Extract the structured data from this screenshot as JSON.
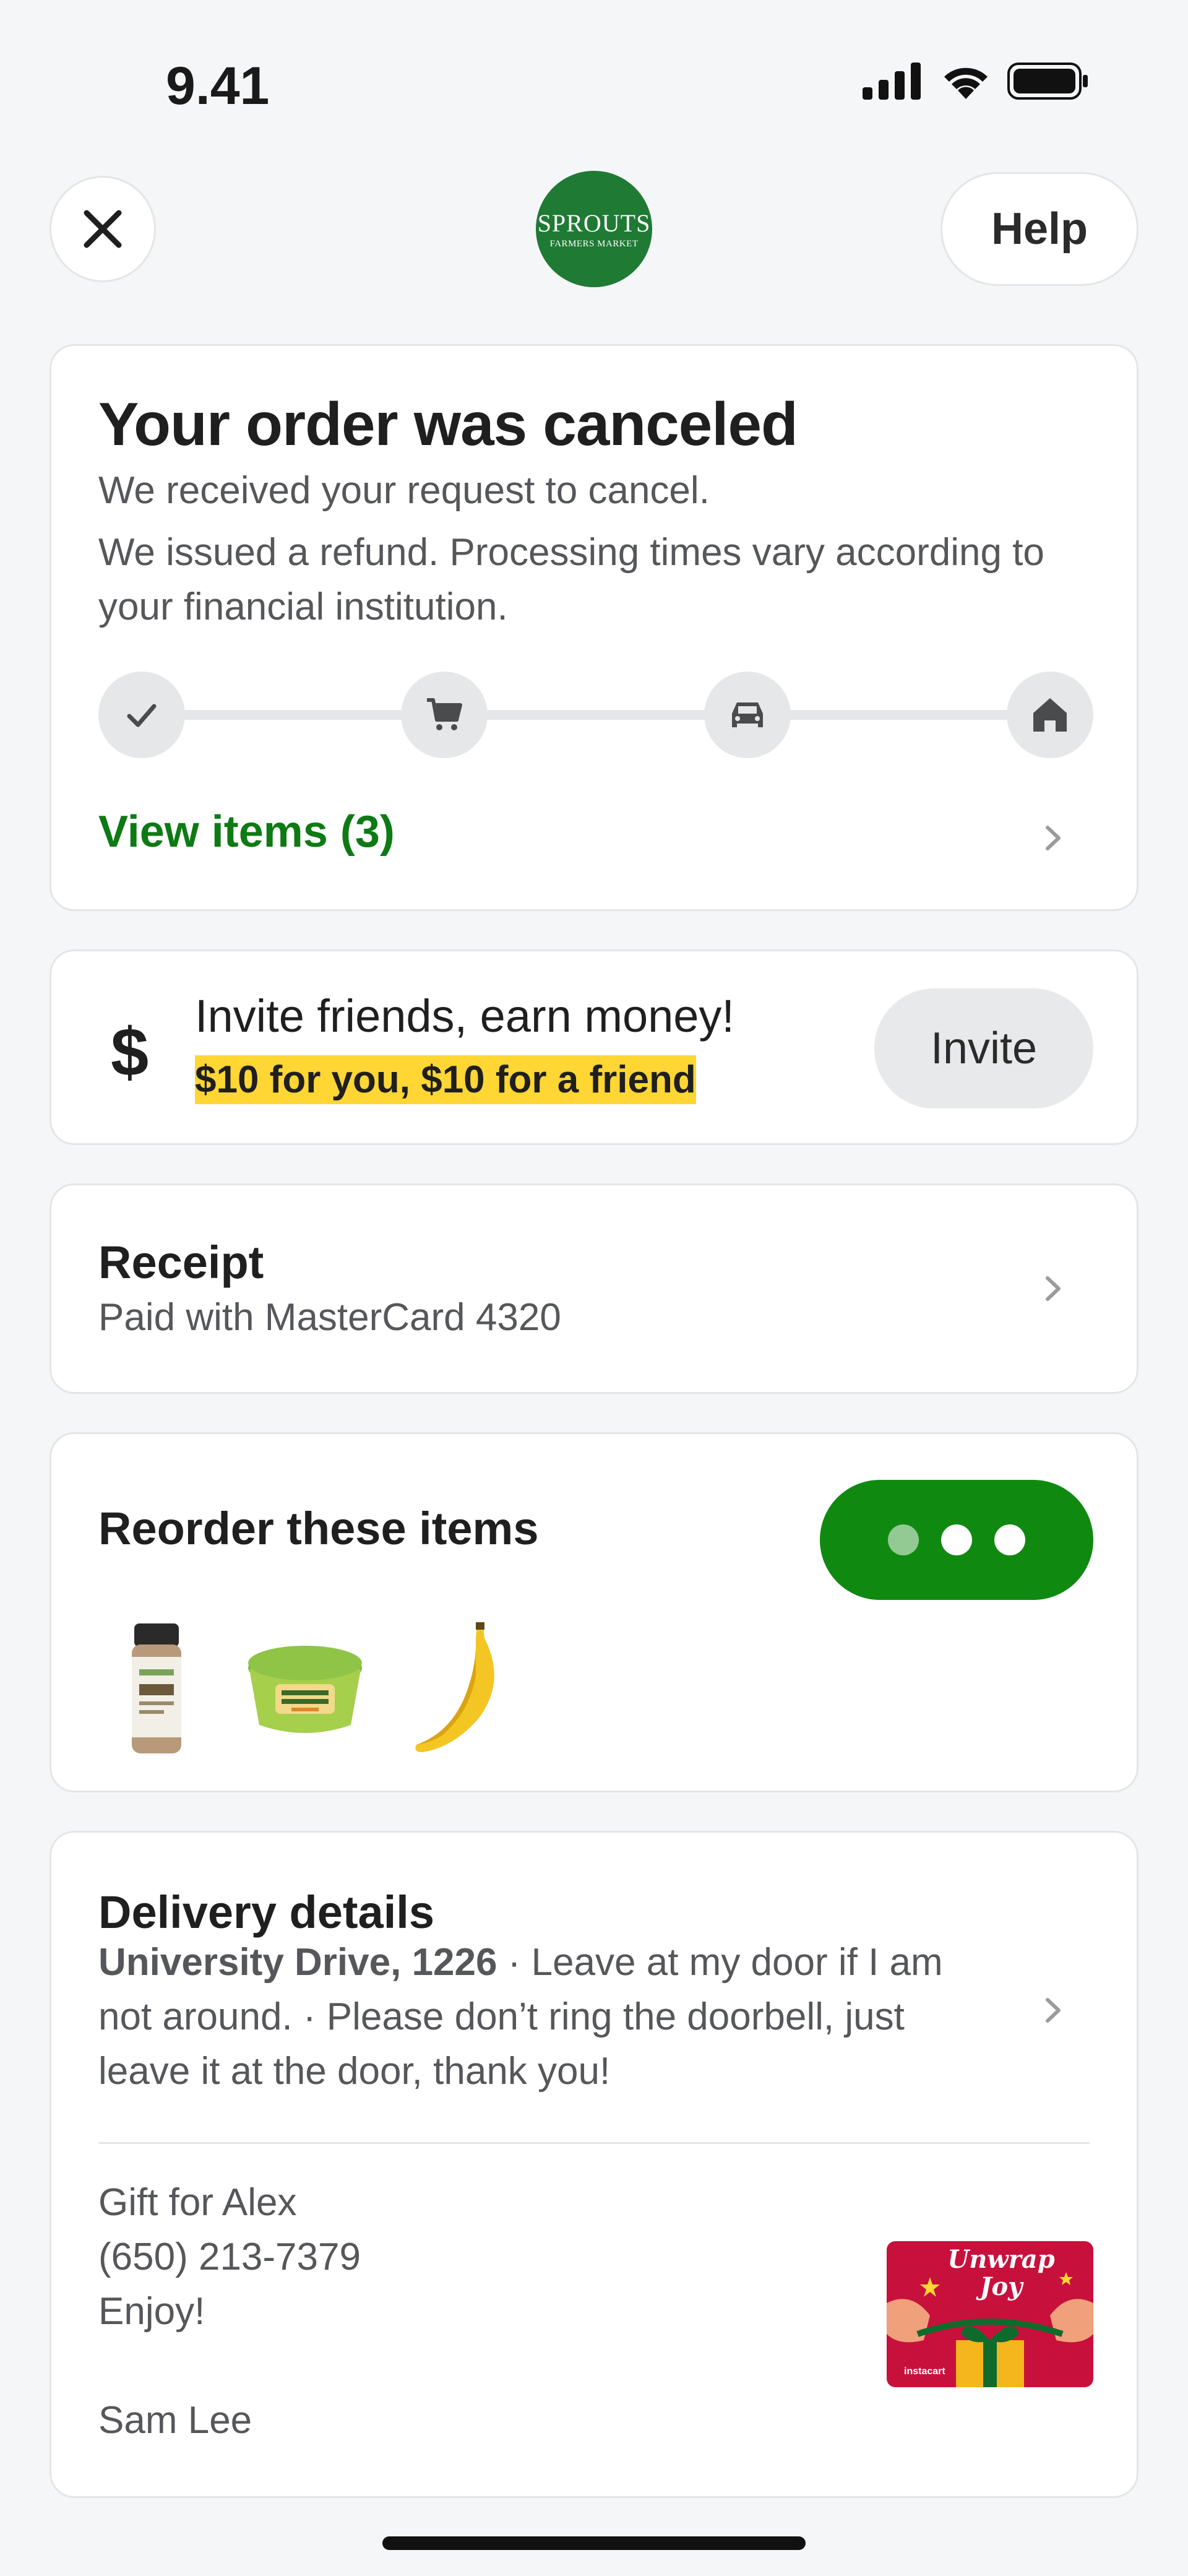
{
  "status_bar": {
    "time": "9.41"
  },
  "header": {
    "logo_line1": "SPROUTS",
    "logo_line2": "FARMERS MARKET",
    "help_label": "Help"
  },
  "order_status": {
    "title": "Your order was canceled",
    "line1": "We received your request to cancel.",
    "line2": "We issued a refund. Processing times vary according to your financial institution.",
    "steps": [
      "check-icon",
      "cart-icon",
      "car-icon",
      "home-icon"
    ],
    "view_items_label": "View items (3)"
  },
  "invite": {
    "title": "Invite friends, earn money!",
    "subtitle": "$10 for you, $10 for a friend",
    "button_label": "Invite",
    "currency_symbol": "$"
  },
  "receipt": {
    "title": "Receipt",
    "subtitle": "Paid with MasterCard 4320"
  },
  "reorder": {
    "title": "Reorder these items",
    "items": [
      "cumin-jar-image",
      "harmless-harvest-cup-image",
      "banana-image"
    ]
  },
  "delivery": {
    "title": "Delivery details",
    "address": "University Drive, 1226",
    "instructions": " · Leave at my door if I am not around. · Please don’t ring the doorbell, just leave it at the door, thank you!",
    "gift_line1": "Gift for Alex",
    "gift_line2": "(650) 213-7379",
    "gift_line3": "Enjoy!",
    "gift_signature": "Sam Lee",
    "gift_card_text": "Unwrap Joy",
    "gift_card_brand": "instacart"
  },
  "colors": {
    "accent_green": "#108910",
    "link_green": "#0e7a14",
    "highlight_yellow": "#ffd633",
    "brand_green": "#1f7a34",
    "gift_red": "#c8103c"
  }
}
